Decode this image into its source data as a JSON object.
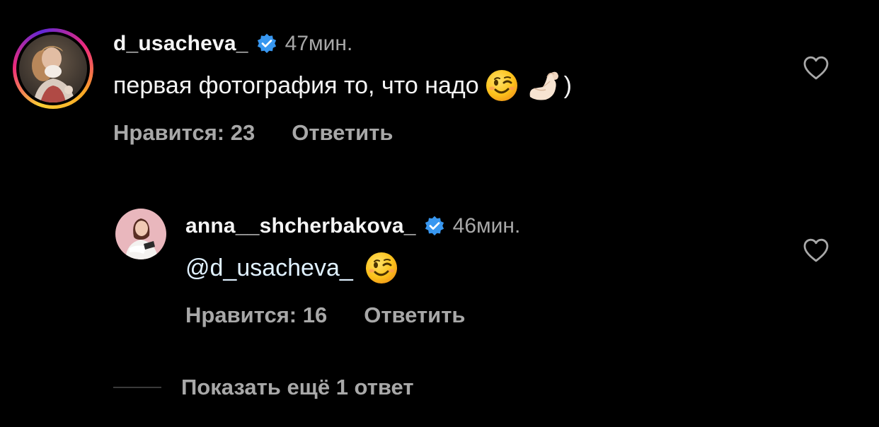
{
  "comments": [
    {
      "username": "d_usacheva_",
      "verified": true,
      "time": "47мин.",
      "text": "первая фотография то, что надо",
      "text_tail": ")",
      "emojis": [
        "winking-face",
        "pinching-hand-light-skin"
      ],
      "likes_label": "Нравится: 23",
      "reply_label": "Ответить",
      "has_story_ring": true
    },
    {
      "username": "anna__shcherbakova_",
      "verified": true,
      "time": "46мин.",
      "mention": "@d_usacheva_",
      "emojis": [
        "winking-face"
      ],
      "likes_label": "Нравится: 16",
      "reply_label": "Ответить",
      "has_story_ring": false
    }
  ],
  "more_replies_label": "Показать ещё 1 ответ",
  "colors": {
    "background": "#000000",
    "text_primary": "#f5f5f5",
    "text_secondary": "#a8a8a8",
    "verified_blue": "#3897f0",
    "mention": "#e0f1ff"
  },
  "icons": {
    "like": "heart-outline-icon",
    "verified": "verified-badge-icon"
  }
}
